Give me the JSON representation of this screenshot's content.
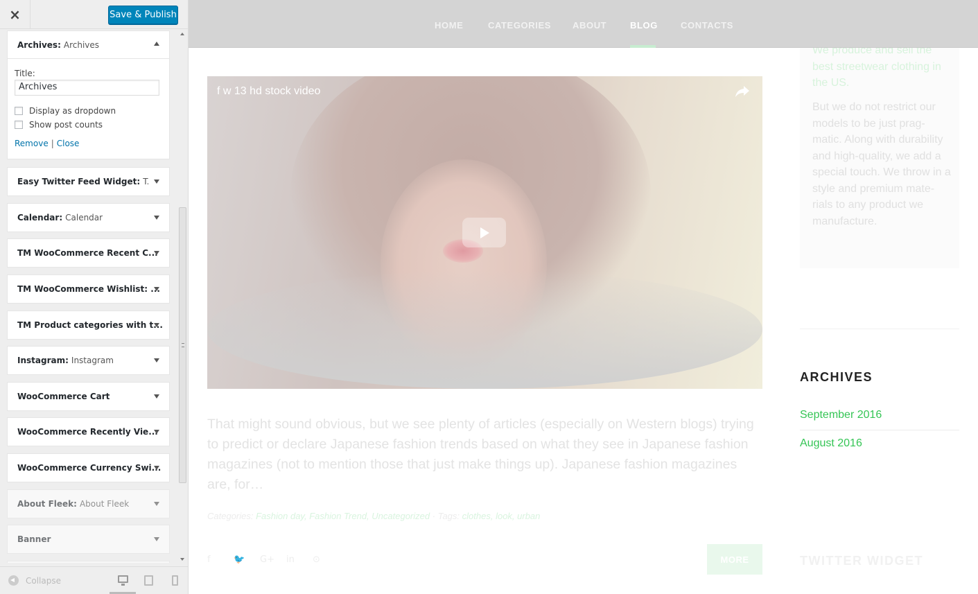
{
  "customizer": {
    "close_label": "×",
    "save_label": "Save & Publish",
    "archives_widget": {
      "name": "Archives",
      "subtitle": "Archives",
      "title_label": "Title:",
      "title_value": "Archives",
      "checkbox_dropdown": "Display as dropdown",
      "checkbox_counts": "Show post counts",
      "remove_label": "Remove",
      "separator": "|",
      "close_label": "Close"
    },
    "widgets": [
      {
        "name": "Easy Twitter Feed Widget",
        "subtitle": "Tw..."
      },
      {
        "name": "Calendar",
        "subtitle": "Calendar"
      },
      {
        "name": "TM WooCommerce Recent C...",
        "subtitle": ""
      },
      {
        "name": "TM WooCommerce Wishlist: ...",
        "subtitle": ""
      },
      {
        "name": "TM Product categories with t...",
        "subtitle": ""
      },
      {
        "name": "Instagram",
        "subtitle": "Instagram"
      },
      {
        "name": "WooCommerce Cart",
        "subtitle": ""
      },
      {
        "name": "WooCommerce Recently Vie...",
        "subtitle": ""
      },
      {
        "name": "WooCommerce Currency Swi...",
        "subtitle": ""
      },
      {
        "name": "About Fleek",
        "subtitle": "About Fleek"
      },
      {
        "name": "Banner",
        "subtitle": ""
      }
    ],
    "footer": {
      "collapse_label": "Collapse"
    }
  },
  "preview": {
    "nav": {
      "items": [
        "HOME",
        "CATEGORIES",
        "ABOUT",
        "BLOG",
        "CONTACTS"
      ],
      "active": "BLOG"
    },
    "video": {
      "title": "f w 13 hd stock video"
    },
    "excerpt": "That might sound obvious, but we see plenty of articles (especially on Western blogs) trying to predict or declare Japanese fashion trends based on what they see in Japanese fashion magazines (not to mention those that just make things up). Japanese fashion magazines are, for…",
    "meta": {
      "categories_label": "Categories:",
      "categories": "Fashion day, Fashion Trend, Uncategorized",
      "dot": "·",
      "tags_label": "Tags:",
      "tags": "clothes, look, urban"
    },
    "more_label": "MORE",
    "about": {
      "green_text": "We produce and sell the best streetwear clothing in the US.",
      "body_text": "But we do not restrict our models to be just prag-matic. Along with durability and high-quality, we add a special touch. We throw in a style and premium mate-rials to any product we manufacture."
    },
    "archives": {
      "heading": "ARCHIVES",
      "links": [
        "September 2016",
        "August 2016"
      ]
    },
    "twitter_heading": "TWITTER WIDGET",
    "colors": {
      "accent": "#35c555",
      "button": "#0085ba",
      "nav_bg": "#d4d4d4"
    }
  }
}
